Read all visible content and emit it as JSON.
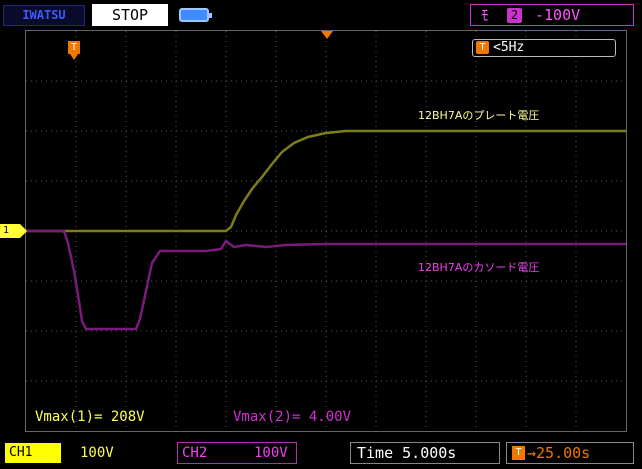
{
  "header": {
    "brand": "IWATSU",
    "run_state": "STOP",
    "trigger": {
      "edge_symbol": "ﾓ",
      "channel": "2",
      "level": "-100V"
    }
  },
  "screen": {
    "trigger_freq": "<5Hz",
    "trigger_icon": "T",
    "ch1_marker": "1",
    "label_ch1": "12BH7Aのプレート電圧",
    "label_ch2": "12BH7Aのカソード電圧",
    "vmax1": "Vmax(1)= 208V",
    "vmax2": "Vmax(2)= 4.00V"
  },
  "footer": {
    "ch1_tag": "CH1",
    "ch1_scale": "100V",
    "ch2_tag": "CH2",
    "ch2_scale": "100V",
    "time_base": "Time 5.000s",
    "trigger_delay": "→25.00s"
  },
  "colors": {
    "ch1": "#ffff33",
    "ch2": "#cc33cc",
    "trigger": "#f07800"
  },
  "icons": [
    "battery-icon",
    "trigger-icon",
    "coupling-dc-icon"
  ]
}
